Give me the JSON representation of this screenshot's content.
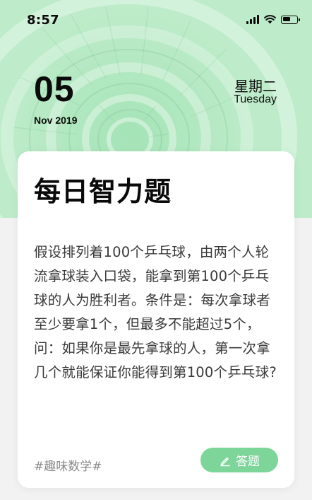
{
  "status_bar": {
    "time": "8:57",
    "icons": [
      "signal-icon",
      "wifi-icon",
      "battery-icon"
    ],
    "battery_level": 0.6
  },
  "date": {
    "day": "05",
    "month_year": "Nov 2019",
    "weekday_cn": "星期二",
    "weekday_en": "Tuesday"
  },
  "card": {
    "title": "每日智力题",
    "body": "假设排列着100个乒乓球，由两个人轮流拿球装入口袋，能拿到第100个乒乓球的人为胜利者。条件是：每次拿球者至少要拿1个，但最多不能超过5个，问：如果你是最先拿球的人，第一次拿几个就能保证你能得到第100个乒乓球?",
    "tag": "#趣味数学#",
    "answer_button": {
      "label": "答题",
      "icon": "pen-icon"
    }
  },
  "colors": {
    "header_green": "#9ee0b1",
    "button_green": "#7ed59a",
    "page_background": "#f2f2f2",
    "card_background": "#ffffff"
  }
}
